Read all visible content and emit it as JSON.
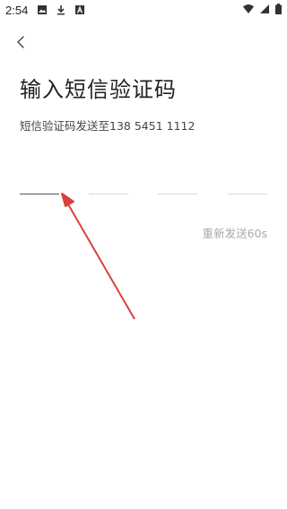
{
  "status_bar": {
    "time": "2:54",
    "icons": [
      "image-icon",
      "download-icon",
      "a-box-icon",
      "wifi-icon",
      "signal-icon",
      "battery-icon"
    ]
  },
  "header": {
    "back_icon": "chevron-left-icon"
  },
  "main": {
    "title": "输入短信验证码",
    "subtitle": "短信验证码发送至138 5451 1112",
    "code_slots": [
      "",
      "",
      "",
      ""
    ],
    "resend_label": "重新发送60s"
  },
  "colors": {
    "annotation_arrow": "#d9413e",
    "active_underline": "#555555",
    "inactive_underline": "#d8d8d8",
    "resend_text": "#a8a8a8"
  }
}
